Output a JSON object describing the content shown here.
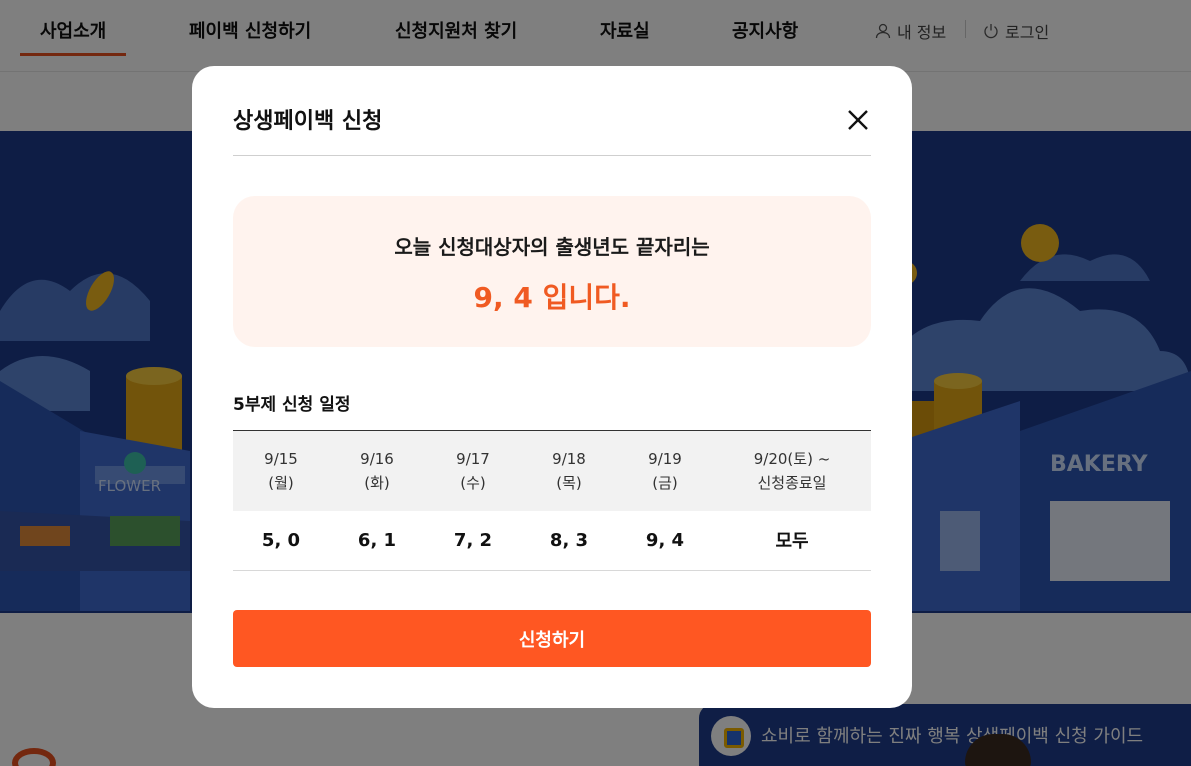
{
  "nav": {
    "items": [
      {
        "label": "사업소개",
        "active": true
      },
      {
        "label": "페이백 신청하기",
        "active": false
      },
      {
        "label": "신청지원처 찾기",
        "active": false
      },
      {
        "label": "자료실",
        "active": false
      },
      {
        "label": "공지사항",
        "active": false
      }
    ],
    "util": {
      "myinfo": {
        "label": "내 정보",
        "icon": "user-icon"
      },
      "login": {
        "label": "로그인",
        "icon": "power-icon"
      }
    }
  },
  "hero": {
    "shop_signs": [
      "FLOWER",
      "BAKERY"
    ]
  },
  "video": {
    "title": "쇼비로 함께하는 진짜 행복 상생페이백 신청 가이드"
  },
  "modal": {
    "title": "상생페이백 신청",
    "close_icon": "close-icon",
    "notice": {
      "line1": "오늘 신청대상자의 출생년도 끝자리는",
      "digits": "9, 4 입니다."
    },
    "schedule_title": "5부제 신청 일정",
    "schedule": {
      "headers": [
        {
          "line1": "9/15",
          "line2": "(월)"
        },
        {
          "line1": "9/16",
          "line2": "(화)"
        },
        {
          "line1": "9/17",
          "line2": "(수)"
        },
        {
          "line1": "9/18",
          "line2": "(목)"
        },
        {
          "line1": "9/19",
          "line2": "(금)"
        },
        {
          "line1": "9/20(토) ~",
          "line2": "신청종료일"
        }
      ],
      "values": [
        "5, 0",
        "6, 1",
        "7, 2",
        "8, 3",
        "9, 4",
        "모두"
      ]
    },
    "apply_label": "신청하기"
  },
  "colors": {
    "accent": "#ff5722",
    "accent_text": "#f05a22",
    "notice_bg": "#fff3ee",
    "hero_bg": "#1d3a8a"
  }
}
